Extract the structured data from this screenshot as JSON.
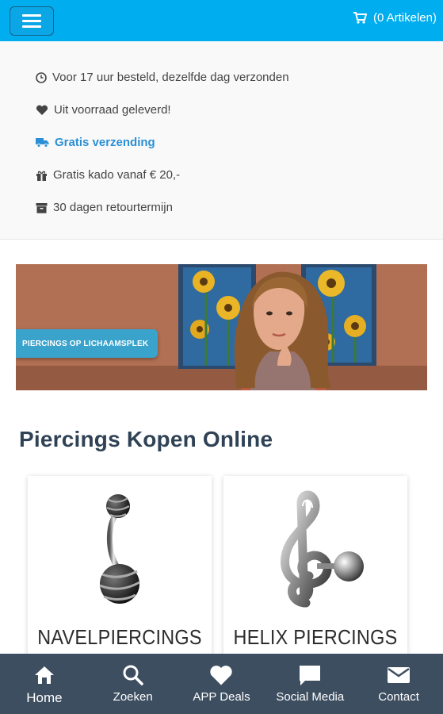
{
  "header": {
    "cart_label": "(0 Artikelen)",
    "accent_color": "#00aeef"
  },
  "usps": [
    {
      "icon": "clock-icon",
      "label": "Voor 17 uur besteld, dezelfde dag verzonden"
    },
    {
      "icon": "heart-icon",
      "label": "Uit voorraad geleverd!"
    },
    {
      "icon": "truck-icon",
      "label": "Gratis verzending"
    },
    {
      "icon": "gift-icon",
      "label": "Gratis kado vanaf € 20,-"
    },
    {
      "icon": "archive-icon",
      "label": "30 dagen retourtermijn"
    }
  ],
  "banner": {
    "label": "PIERCINGS OP LICHAAMSPLEK"
  },
  "main": {
    "title": "Piercings Kopen Online",
    "categories": [
      {
        "label": "NAVELPIERCINGS",
        "icon": "navel-piercing-icon"
      },
      {
        "label": "HELIX PIERCINGS",
        "icon": "helix-piercing-icon"
      }
    ]
  },
  "bottom_nav": {
    "background": "#3d4e60",
    "items": [
      {
        "label": "Home",
        "icon": "home-icon"
      },
      {
        "label": "Zoeken",
        "icon": "search-icon"
      },
      {
        "label": "APP Deals",
        "icon": "heart-icon"
      },
      {
        "label": "Social Media",
        "icon": "chat-icon"
      },
      {
        "label": "Contact",
        "icon": "mail-icon"
      }
    ]
  }
}
